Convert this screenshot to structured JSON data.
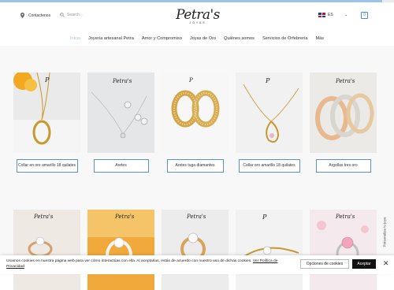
{
  "header": {
    "contact_label": "Contactenos",
    "search_placeholder": "Search...",
    "logo_text": "Petra's",
    "logo_sub": "JOYAS",
    "language": "ES",
    "currency": "",
    "cart_count": "0"
  },
  "nav": {
    "items": [
      "Inicio",
      "Joyería artesanal Petra",
      "Amor y Compromiso",
      "Joyas de Oro",
      "Quiénes somos",
      "Servicios de Orfebrería",
      "Más"
    ]
  },
  "products_row1": [
    {
      "label": "Collar en oro amarillo 18 quilates"
    },
    {
      "label": "Aretes"
    },
    {
      "label": "Aretes tuga diamantes"
    },
    {
      "label": "Collar oro amarillo 18 quilates"
    },
    {
      "label": "Argollas tres oro"
    }
  ],
  "sidebar_tab": "Personaliza tu joya",
  "cookie": {
    "message": "Usamos cookies en nuestra página web para ver cómo interactúas con ella. Al aceptarlas, estás de acuerdo con nuestro uso de dichas cookies.",
    "link": "Ver Política de Privacidad",
    "options_label": "Opciones de cookies",
    "accept_label": "Aceptar",
    "close_label": "✕"
  },
  "colors": {
    "accent": "#5c8fc4",
    "nav_active": "#a8c4e0",
    "background_band": "#f8f8f9"
  }
}
